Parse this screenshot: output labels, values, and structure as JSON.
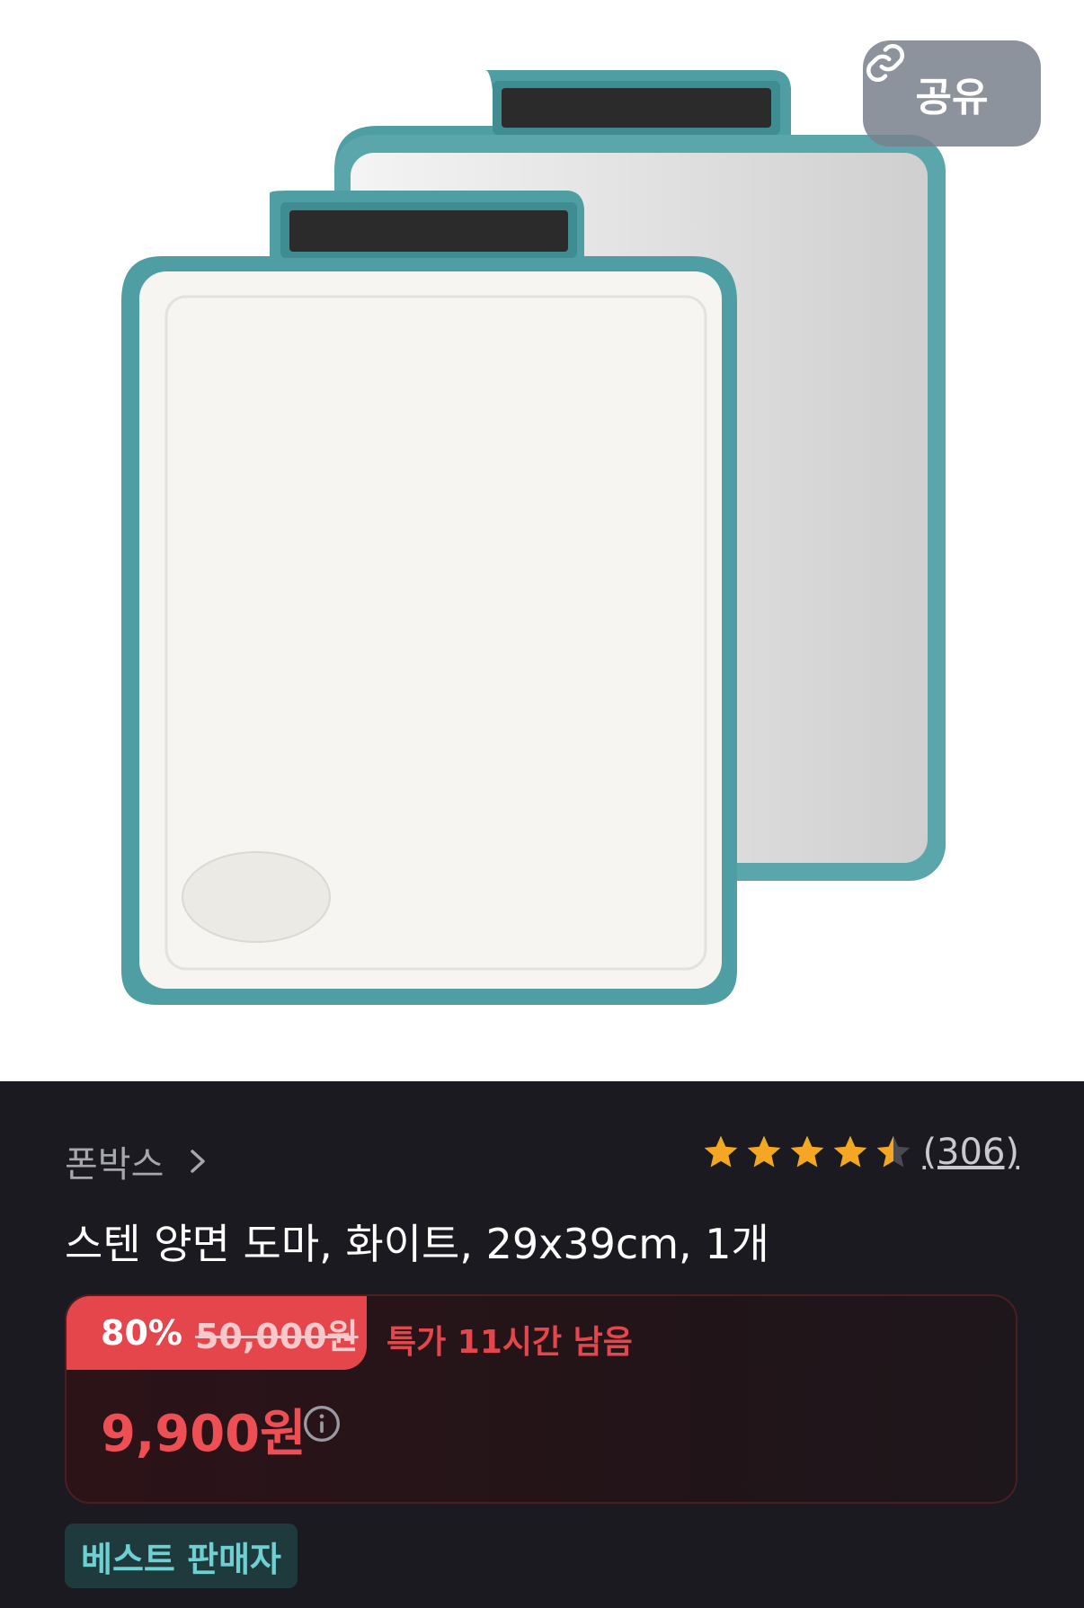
{
  "share": {
    "label": "공유",
    "icon": "link-icon"
  },
  "seller": {
    "name": "폰박스",
    "icon": "chevron-right-icon"
  },
  "rating": {
    "score": 4.5,
    "max": 5,
    "count": "(306)",
    "star_color": "#f5a623"
  },
  "product": {
    "title": "스텐 양면 도마, 화이트, 29x39cm, 1개"
  },
  "price": {
    "discount_rate": "80%",
    "original": "50,000원",
    "deal_timer": "특가 11시간 남음",
    "sale": "9,900원",
    "info_icon": "info-circle-icon",
    "accent": "#e5464c"
  },
  "badge": {
    "label": "베스트 판매자"
  }
}
